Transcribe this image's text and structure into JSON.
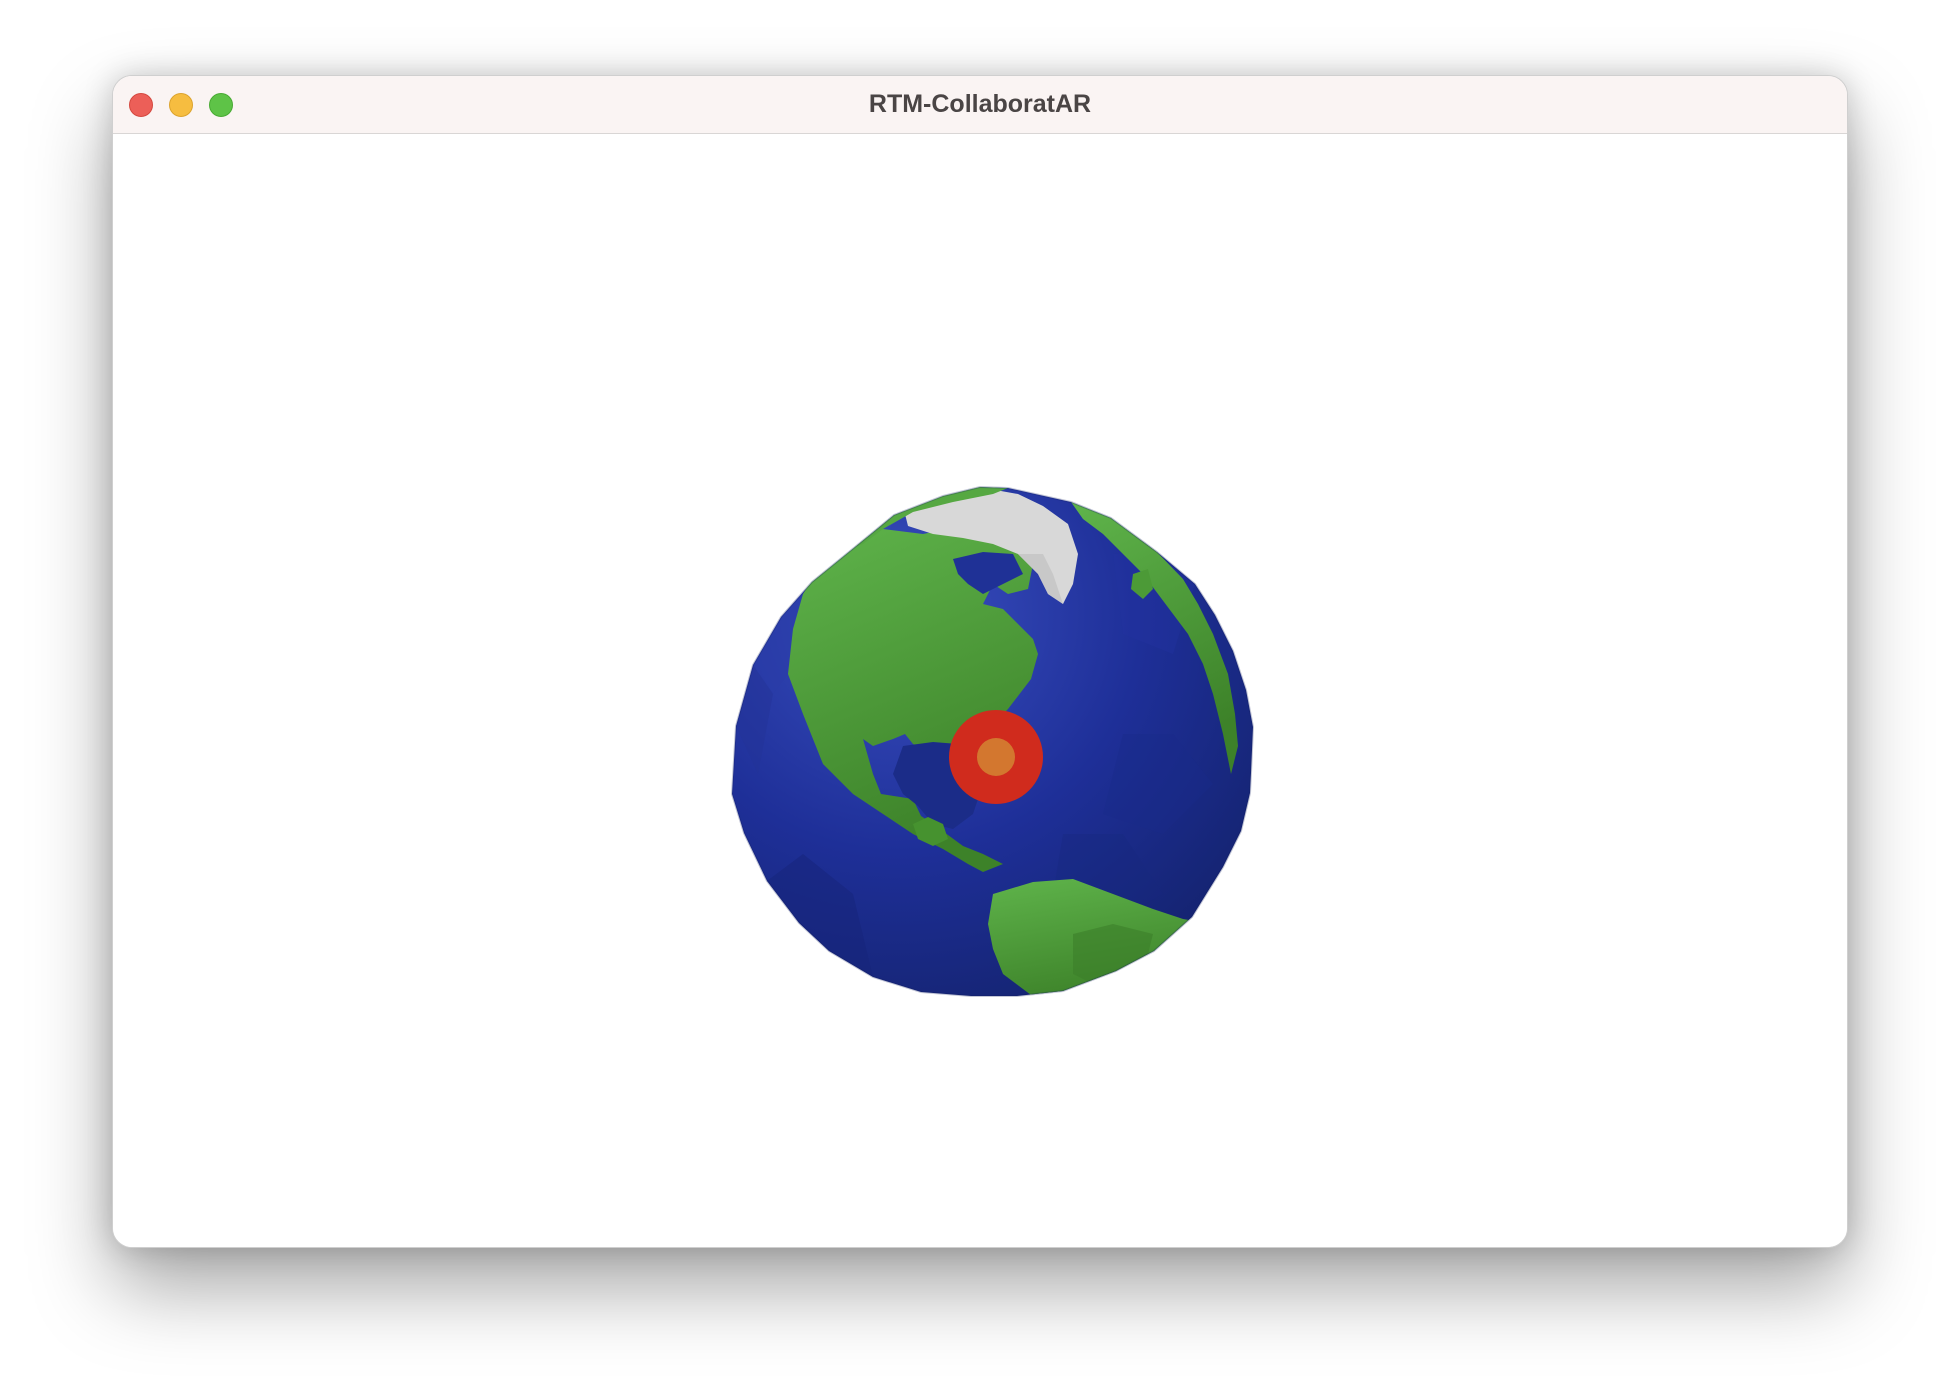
{
  "window": {
    "title": "RTM-CollaboratAR",
    "controls": {
      "close": "close-button",
      "minimize": "minimize-button",
      "zoom": "zoom-button"
    }
  },
  "colors": {
    "ocean_light": "#2f44b4",
    "ocean_dark": "#16277e",
    "land_light": "#5aac45",
    "land_dark": "#3f862c",
    "ice": "#dadada",
    "marker_outer": "#d02b1d",
    "marker_inner": "#d3772f"
  },
  "scene": {
    "object": "globe",
    "marker": "location-marker"
  }
}
